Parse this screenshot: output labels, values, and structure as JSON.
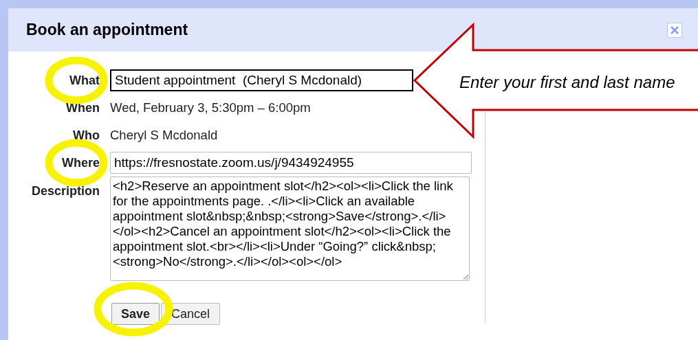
{
  "dialog": {
    "title": "Book an appointment"
  },
  "fields": [
    {
      "label": "What",
      "kind": "input",
      "value": "Student appointment  (Cheryl S Mcdonald)",
      "highlighted": true
    },
    {
      "label": "When",
      "kind": "text",
      "value": "Wed, February 3, 5:30pm – 6:00pm",
      "highlighted": false
    },
    {
      "label": "Who",
      "kind": "text",
      "value": "Cheryl S Mcdonald",
      "highlighted": false
    },
    {
      "label": "Where",
      "kind": "input",
      "value": "https://fresnostate.zoom.us/j/9434924955",
      "highlighted": true
    },
    {
      "label": "Description",
      "kind": "textarea",
      "value": "<h2>Reserve an appointment slot</h2><ol><li>Click the link for the appointments page. .</li><li>Click an available appointment slot&nbsp;&nbsp;<strong>Save</strong>.</li></ol><h2>Cancel an appointment slot</h2><ol><li>Click the appointment slot.<br></li><li>Under “Going?” click&nbsp;<strong>No</strong>.</li></ol><ol></ol>",
      "highlighted": false
    }
  ],
  "buttons": [
    {
      "label": "Save",
      "kind": "primary",
      "highlighted": true
    },
    {
      "label": "Cancel",
      "kind": "secondary",
      "highlighted": false
    }
  ],
  "callout": {
    "text": "Enter your first and last name"
  }
}
